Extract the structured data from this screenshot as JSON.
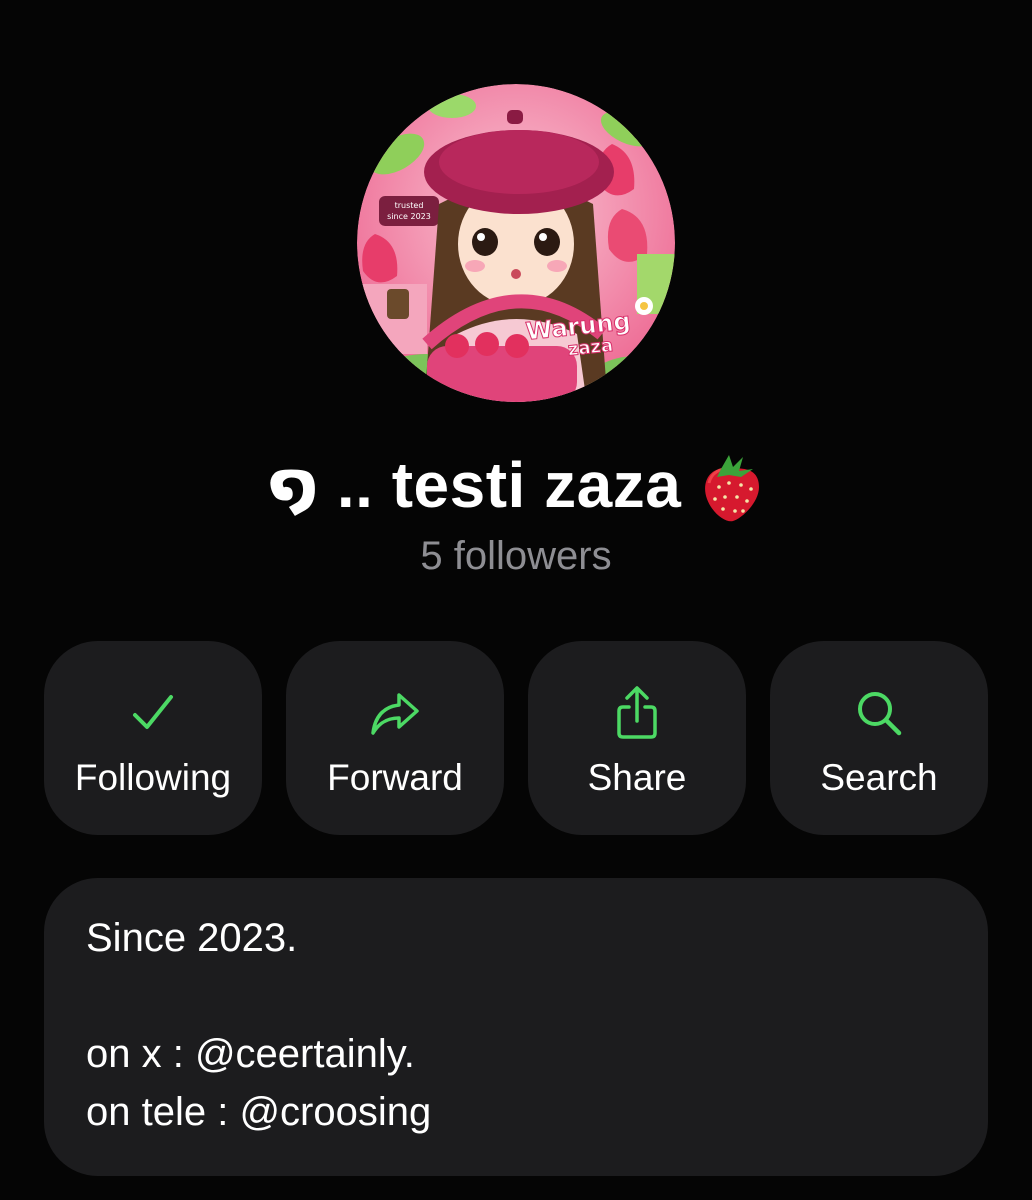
{
  "profile": {
    "avatar_text": "Warung zaza",
    "avatar_badge": "trusted since 2023",
    "name": "໑ .. testi zaza",
    "name_emoji_icon": "strawberry-icon",
    "followers": "5 followers"
  },
  "actions": [
    {
      "label": "Following",
      "icon": "check-icon"
    },
    {
      "label": "Forward",
      "icon": "forward-arrow-icon"
    },
    {
      "label": "Share",
      "icon": "share-icon"
    },
    {
      "label": "Search",
      "icon": "search-icon"
    }
  ],
  "bio": {
    "line1": "Since 2023.",
    "line2": "on x : @ceertainly.",
    "line3": "on tele : @croosing"
  },
  "colors": {
    "background": "#050505",
    "card": "#1c1c1e",
    "accent": "#4cd964",
    "secondary_text": "#8e8e93"
  }
}
